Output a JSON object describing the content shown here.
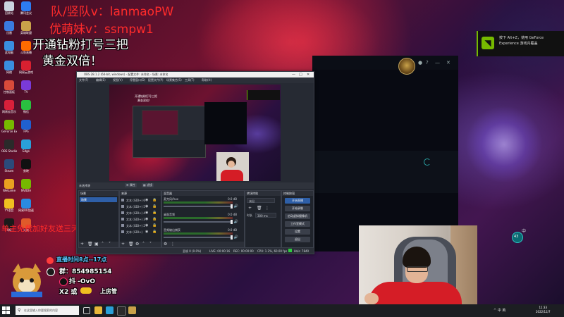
{
  "overlays": {
    "line1_red": "队/竖队v：lanmaoPW",
    "line2_red": "优萌妹v：ssmpw1",
    "line3_white": "开通钻粉打号三把",
    "line4_white": "黄金双倍！",
    "scroll_red": "单主免费加好友送三天免费体验"
  },
  "desktop_icons": [
    {
      "label": "回收站",
      "color": "#c9d3de"
    },
    {
      "label": "迅雷",
      "color": "#3a7be0"
    },
    {
      "label": "此电脑",
      "color": "#3a8ee0"
    },
    {
      "label": "网络",
      "color": "#3a8ee0"
    },
    {
      "label": "控制面板",
      "color": "#d84a3a"
    },
    {
      "label": "网易云音乐",
      "color": "#d8203a"
    },
    {
      "label": "GeForce Experience",
      "color": "#76b900"
    },
    {
      "label": "OBS Studio",
      "color": "#2a2a2a"
    },
    {
      "label": "Steam",
      "color": "#2b4a7a"
    },
    {
      "label": "WeGame",
      "color": "#e8a020"
    },
    {
      "label": "YY语音",
      "color": "#f0c020"
    },
    {
      "label": "QQ",
      "color": "#1a1a1a"
    },
    {
      "label": "腾讯会议",
      "color": "#2d7cf0"
    },
    {
      "label": "英雄联盟",
      "color": "#c9a24a"
    },
    {
      "label": "斗鱼直播",
      "color": "#ff6a00"
    },
    {
      "label": "网易云游戏",
      "color": "#d82030"
    },
    {
      "label": "TV",
      "color": "#7a3ad8"
    },
    {
      "label": "微信",
      "color": "#2ac040"
    },
    {
      "label": "FPS",
      "color": "#2060d0"
    },
    {
      "label": "Edge",
      "color": "#2aa0d8"
    },
    {
      "label": "剪映",
      "color": "#111111"
    },
    {
      "label": "NVIDIA",
      "color": "#76b900"
    },
    {
      "label": "网易UU加速器",
      "color": "#2a8ae0"
    },
    {
      "label": "火绒",
      "color": "#e05a2a"
    }
  ],
  "nvidia_toast": {
    "text": "按下 Alt+Z，使用 GeForce Experience 游戏内覆盖"
  },
  "obs": {
    "title": "OBS 28.1.2 (64-bit, windows) - 配置文件: 未命名 - 场景: 未命名",
    "menu": [
      "文件(F)",
      "编辑(E)",
      "视图(V)",
      "停靠窗口(D)",
      "配置文件(P)",
      "场景集合(S)",
      "工具(T)",
      "帮助(H)"
    ],
    "source_bar_label": "未选择源",
    "source_bar_props": "属性",
    "source_bar_filters": "滤镜",
    "docks": {
      "scenes_title": "场景",
      "scene_item": "场景",
      "sources_title": "来源",
      "mixer_title": "混音器",
      "transitions_title": "转场特效",
      "controls_title": "控制按钮"
    },
    "sources": [
      "文本 (GDI+) 6",
      "文本 (GDI+) 5",
      "文本 (GDI+) 4",
      "文本 (GDI+) 3",
      "文本 (GDI+) 2",
      "文本 (GDI+)"
    ],
    "mixer": [
      {
        "name": "麦克风/Aux",
        "db": "0.0 dB"
      },
      {
        "name": "桌面音频",
        "db": "0.0 dB"
      },
      {
        "name": "音频输出捕获",
        "db": "0.0 dB"
      }
    ],
    "transition": {
      "type_value": "淡出",
      "duration_label": "时长",
      "duration_value": "300 ms"
    },
    "controls": [
      "开始直播",
      "开始录制",
      "启动虚拟摄像机",
      "工作室模式",
      "设置",
      "退出"
    ],
    "status": {
      "dropped": "丢帧 0 (0.0%)",
      "live": "LIVE: 00:00:16",
      "rec": "REC: 00:00:00",
      "cpu": "CPU: 1.2%, 60.00 fps",
      "kbps": "kb/s: 7840"
    }
  },
  "preview_texts": {
    "l1": "开通钻粉打号三把",
    "l2": "黄金双倍！"
  },
  "info": {
    "time_line": "直播时间8点--17点",
    "group_label": "群：",
    "group_number": "854985154",
    "dou_line": "抖 -OvO",
    "x2_line": "X2 或",
    "onboard_line": "上房管"
  },
  "right_chip": {
    "bubble": "43",
    "badge": "中"
  },
  "taskbar": {
    "search_placeholder": "在这里输入你要搜索的内容",
    "tray": "^ 中 英",
    "time": "11:33",
    "date": "2022/12/7"
  },
  "colors": {
    "obs_bg": "#262a33",
    "accent_blue": "#2e5fa8",
    "nvidia_green": "#76b900",
    "red_overlay": "#ff2b2b"
  }
}
